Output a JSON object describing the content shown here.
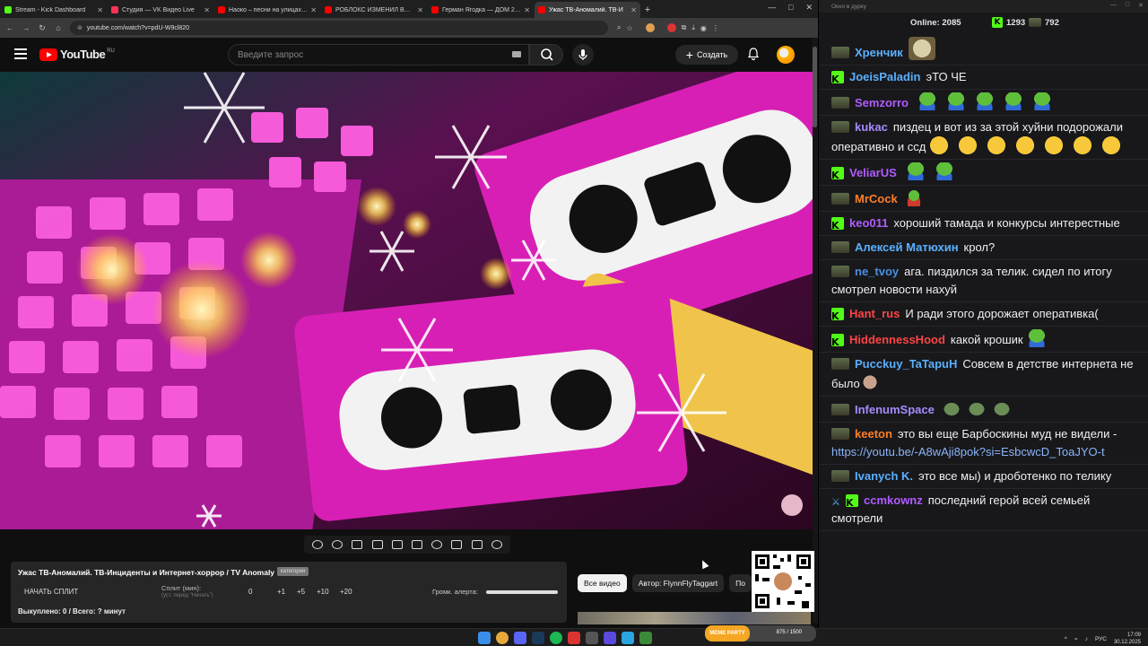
{
  "browser": {
    "tabs": [
      {
        "label": "Stream - Kick Dashboard",
        "color": "#53fc18",
        "active": false
      },
      {
        "label": "Студия — VK Видео Live",
        "color": "#ff3355",
        "active": false
      },
      {
        "label": "Наоко – песни на улицах: арс",
        "color": "#ff0000",
        "active": false
      },
      {
        "label": "РОБЛОКС ИЗМЕНИЛ ВСЮ МО",
        "color": "#ff0000",
        "active": false
      },
      {
        "label": "Герман Ягодка — ДОМ 2 и ак",
        "color": "#ff0000",
        "active": false
      },
      {
        "label": "Ужас ТВ-Аномалий. ТВ-И",
        "color": "#ff0000",
        "active": true
      }
    ],
    "url": "youtube.com/watch?v=pdU-W9cl820"
  },
  "youtube": {
    "logo_text": "YouTube",
    "region": "RU",
    "search_placeholder": "Введите запрос",
    "create_label": "Создать"
  },
  "overlay": {
    "title": "Ужас ТВ-Аномалий. ТВ-Инциденты и Интернет-хоррор / TV Anomaly",
    "badge": "категория",
    "split_button": "НАЧАТЬ СПЛИТ",
    "split_minutes_label": "Сплит (мин):",
    "split_hint": "(уст. перед \"Начать\")",
    "split_value": "0",
    "increments": [
      "+1",
      "+5",
      "+10",
      "+20"
    ],
    "alert_volume_label": "Громк. алерта:",
    "alert_volume": 1.0,
    "bought": "Выкуплено: 0 / Всего: ? минут"
  },
  "chips": [
    {
      "label": "Все видео",
      "active": true
    },
    {
      "label": "Автор: FlynnFlyTaggart",
      "active": false
    },
    {
      "label": "По",
      "active": false
    }
  ],
  "chat": {
    "window_title": "Окно в дурку",
    "online_label": "Online:",
    "online_count": "2085",
    "kick_count": "1293",
    "twitch_count": "792",
    "messages": [
      {
        "platform": "twitch",
        "user": "Хренчик",
        "color": "#5ab0ff",
        "text": "",
        "emotes": [
          "pic"
        ]
      },
      {
        "platform": "kick",
        "user": "JoeisPaladin",
        "color": "#5ab0ff",
        "text": "эТО ЧЕ",
        "emotes": []
      },
      {
        "platform": "twitch",
        "user": "Semzorro",
        "color": "#b05cff",
        "text": "",
        "emotes": [
          "pepe",
          "pepe",
          "pepe",
          "pepe",
          "pepe"
        ]
      },
      {
        "platform": "twitch",
        "user": "kukac",
        "color": "#a78bff",
        "text": "пиздец и вот из за этой хуйни подорожали оперативно и ссд",
        "emotes": [
          "cat",
          "cat",
          "cat",
          "cat",
          "cat",
          "cat",
          "cat"
        ]
      },
      {
        "platform": "kick",
        "user": "VeliarUS",
        "color": "#b05cff",
        "text": "",
        "emotes": [
          "pepe",
          "pepe"
        ]
      },
      {
        "platform": "twitch",
        "user": "MrCock",
        "color": "#ff7f27",
        "text": "",
        "emotes": [
          "mrcock"
        ]
      },
      {
        "platform": "kick",
        "user": "keo011",
        "color": "#b05cff",
        "text": "хороший тамада и конкурсы интерестные",
        "emotes": []
      },
      {
        "platform": "twitch",
        "user": "Алексей Матюхин",
        "color": "#5ab0ff",
        "text": "крол?",
        "emotes": []
      },
      {
        "platform": "twitch",
        "user": "ne_tvoy",
        "color": "#4a8fe0",
        "text": "ага. пиздился за телик. сидел по итогу смотрел новости нахуй",
        "emotes": []
      },
      {
        "platform": "kick",
        "user": "Hant_rus",
        "color": "#ff4444",
        "text": "И ради этого дорожает оперативка(",
        "emotes": []
      },
      {
        "platform": "kick",
        "user": "HiddennessHood",
        "color": "#ff4444",
        "text": "какой крошик",
        "emotes": [
          "pepe"
        ]
      },
      {
        "platform": "twitch",
        "user": "Pucckuy_TaTapuH",
        "color": "#5ab0ff",
        "text": "Совсем в детстве интернета не было",
        "emotes": [
          "face"
        ]
      },
      {
        "platform": "twitch",
        "user": "InfenumSpace",
        "color": "#a78bff",
        "text": "",
        "emotes": [
          "blob",
          "blob",
          "blob"
        ]
      },
      {
        "platform": "twitch",
        "user": "keeton",
        "color": "#ff7f27",
        "text": "это вы еще Барбоскины муд не видели -",
        "link": "https://youtu.be/-A8wAji8pok?si=EsbcwcD_ToaJYO-t",
        "emotes": []
      },
      {
        "platform": "twitch",
        "user": "Ivanych K.",
        "color": "#5ab0ff",
        "text": "это все мы) и дроботенко по телику",
        "emotes": []
      },
      {
        "platform": "kick",
        "user": "ccmkownz",
        "color": "#b05cff",
        "text": "последний герой всей семьей смотрели",
        "emotes": [],
        "extra_badge": true
      }
    ]
  },
  "taskbar": {
    "meme_label": "MEME PARTY",
    "meme_count": "875 / 1500",
    "lang": "РУС",
    "time": "17:09",
    "date": "30.12.2025"
  }
}
